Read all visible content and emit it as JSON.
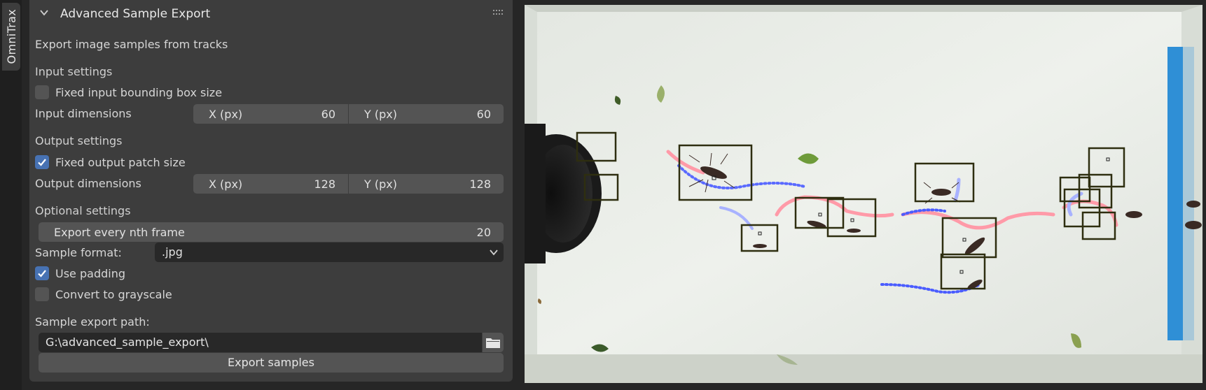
{
  "tab": {
    "label": "OmniTrax"
  },
  "panel": {
    "title": "Advanced Sample Export",
    "description": "Export image samples from tracks",
    "input_section": "Input settings",
    "fixed_input_label": "Fixed input bounding box size",
    "fixed_input_checked": false,
    "input_dimensions_label": "Input dimensions",
    "input_x_label": "X (px)",
    "input_x_value": "60",
    "input_y_label": "Y (px)",
    "input_y_value": "60",
    "output_section": "Output settings",
    "fixed_output_label": "Fixed output patch size",
    "fixed_output_checked": true,
    "output_dimensions_label": "Output dimensions",
    "output_x_label": "X (px)",
    "output_x_value": "128",
    "output_y_label": "Y (px)",
    "output_y_value": "128",
    "optional_section": "Optional settings",
    "nth_frame_label": "Export every nth frame",
    "nth_frame_value": "20",
    "sample_format_label": "Sample format:",
    "sample_format_value": ".jpg",
    "use_padding_label": "Use padding",
    "use_padding_checked": true,
    "grayscale_label": "Convert to grayscale",
    "grayscale_checked": false,
    "export_path_label": "Sample export path:",
    "export_path_value": "G:\\advanced_sample_export\\",
    "export_button": "Export samples"
  },
  "colors": {
    "accent": "#4772b3",
    "panel_bg": "#3d3d3d",
    "field_bg": "#545454",
    "input_bg": "#282828",
    "track_pink": "#ff9aa8",
    "track_blue": "#4a5cff",
    "bbox": "#2e2e10"
  }
}
